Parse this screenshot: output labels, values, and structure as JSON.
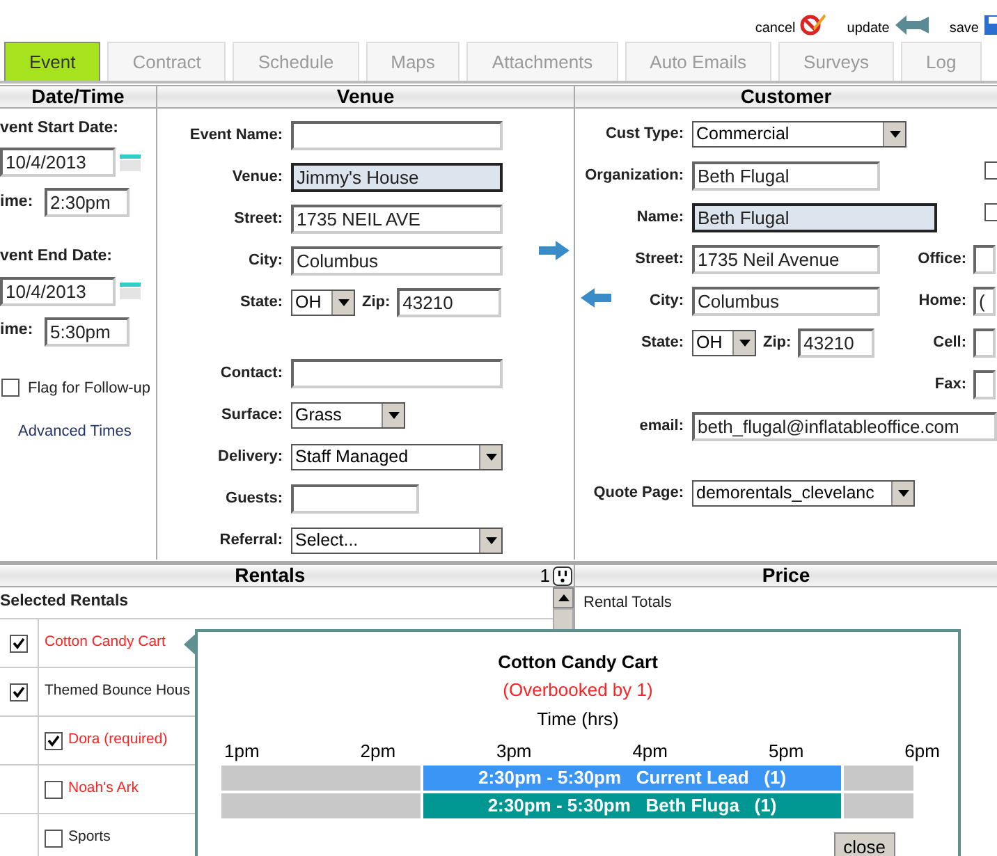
{
  "actions": [
    {
      "kind": "cancel",
      "label": "cancel"
    },
    {
      "kind": "update",
      "label": "update"
    },
    {
      "kind": "save",
      "label": "save"
    }
  ],
  "tabs": [
    {
      "label": "Event",
      "selected": true
    },
    {
      "label": "Contract",
      "selected": false
    },
    {
      "label": "Schedule",
      "selected": false
    },
    {
      "label": "Maps",
      "selected": false
    },
    {
      "label": "Attachments",
      "selected": false
    },
    {
      "label": "Auto Emails",
      "selected": false
    },
    {
      "label": "Surveys",
      "selected": false
    },
    {
      "label": "Log",
      "selected": false
    }
  ],
  "datetime": {
    "title": "Date/Time",
    "start_label": "vent Start Date:",
    "start_date": "10/4/2013",
    "start_time_label": "ime:",
    "start_time": "2:30pm",
    "end_label": "vent End Date:",
    "end_date": "10/4/2013",
    "end_time_label": "ime:",
    "end_time": "5:30pm",
    "follow_up": {
      "label": "Flag for Follow-up",
      "checked": false
    },
    "advanced_link": "Advanced Times"
  },
  "venue": {
    "title": "Venue",
    "rows": [
      {
        "label": "Event Name:",
        "kind": "text",
        "value": "",
        "highlighted": false
      },
      {
        "label": "Venue:",
        "kind": "text",
        "value": "Jimmy's House",
        "highlighted": true
      },
      {
        "label": "Street:",
        "kind": "text",
        "value": "1735 NEIL AVE",
        "highlighted": false
      },
      {
        "label": "City:",
        "kind": "text",
        "value": "Columbus",
        "highlighted": false
      },
      {
        "label": "State:",
        "kind": "state",
        "value": "OH",
        "zip_label": "Zip:",
        "zip": "43210"
      },
      {
        "label": "Contact:",
        "kind": "text",
        "value": "",
        "highlighted": false
      },
      {
        "label": "Surface:",
        "kind": "select",
        "value": "Grass"
      },
      {
        "label": "Delivery:",
        "kind": "select",
        "value": "Staff Managed"
      },
      {
        "label": "Guests:",
        "kind": "text",
        "value": "",
        "highlighted": false
      },
      {
        "label": "Referral:",
        "kind": "select",
        "value": "Select..."
      }
    ]
  },
  "customer": {
    "title": "Customer",
    "rows": [
      {
        "label": "Cust Type:",
        "kind": "select",
        "value": "Commercial"
      },
      {
        "label": "Organization:",
        "kind": "text",
        "value": "Beth Flugal",
        "highlighted": false,
        "extra": {
          "kind": "checkbox",
          "checked": false
        }
      },
      {
        "label": "Name:",
        "kind": "text",
        "value": "Beth Flugal",
        "highlighted": true,
        "extra": {
          "kind": "checkbox",
          "checked": false
        }
      },
      {
        "label": "Street:",
        "kind": "text",
        "value": "1735 Neil Avenue",
        "highlighted": false,
        "extra": {
          "kind": "phone",
          "label": "Office:"
        }
      },
      {
        "label": "City:",
        "kind": "text",
        "value": "Columbus",
        "highlighted": false,
        "extra": {
          "kind": "phone",
          "label": "Home:",
          "value": "("
        }
      },
      {
        "label": "State:",
        "kind": "state",
        "value": "OH",
        "zip_label": "Zip:",
        "zip": "43210",
        "extra": {
          "kind": "phone",
          "label": "Cell:"
        }
      },
      {
        "kind": "blank",
        "extra": {
          "kind": "phone",
          "label": "Fax:"
        }
      },
      {
        "label": "email:",
        "kind": "email",
        "value": "beth_flugal@inflatableoffice.com",
        "highlighted": false
      },
      {
        "label": "Quote Page:",
        "kind": "select",
        "value": "demorentals_clevelanc"
      }
    ]
  },
  "rentals": {
    "title": "Rentals",
    "count": "1",
    "heading": "Selected Rentals",
    "items": [
      {
        "label": "Cotton Candy Cart",
        "checked": true,
        "conflict": true
      },
      {
        "label": "Themed Bounce Hous",
        "checked": true,
        "conflict": false,
        "children": [
          {
            "label": "Dora (required)",
            "checked": true,
            "conflict": true
          },
          {
            "label": "Noah's Ark",
            "checked": false,
            "conflict": true
          },
          {
            "label": "Sports",
            "checked": false,
            "conflict": false
          }
        ]
      }
    ]
  },
  "price": {
    "title": "Price",
    "totals_label": "Rental Totals"
  },
  "popup": {
    "title": "Cotton Candy Cart",
    "subtitle": "(Overbooked by 1)",
    "axis_label": "Time (hrs)",
    "ticks": [
      "1pm",
      "2pm",
      "3pm",
      "4pm",
      "5pm",
      "6pm"
    ],
    "bookings": [
      {
        "label": "2:30pm - 5:30pm   Current Lead   (1)",
        "color": "#3a95f5"
      },
      {
        "label": "2:30pm - 5:30pm   Beth Fluga   (1)",
        "color": "#009691"
      }
    ],
    "close": "close"
  }
}
